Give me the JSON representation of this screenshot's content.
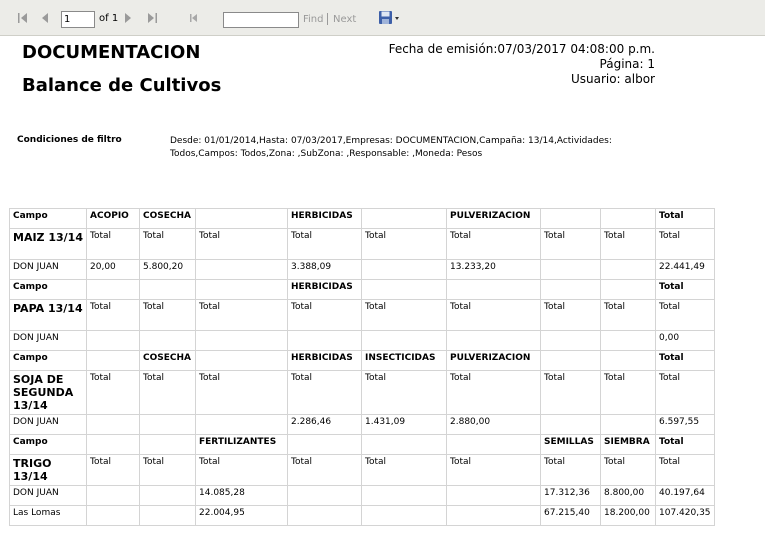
{
  "toolbar": {
    "page_value": "1",
    "of_label": "of 1",
    "find_label": "Find",
    "separator": "|",
    "next_label": "Next"
  },
  "report": {
    "company": "DOCUMENTACION",
    "title": "Balance de Cultivos",
    "emission": "Fecha de emisión:07/03/2017 04:08:00 p.m.",
    "page": "Página: 1",
    "user": "Usuario: albor",
    "filter_label": "Condiciones de filtro",
    "filter_text": "Desde: 01/01/2014,Hasta: 07/03/2017,Empresas: DOCUMENTACION,Campaña: 13/14,Actividades: Todos,Campos: Todos,Zona: ,SubZona: ,Responsable: ,Moneda: Pesos"
  },
  "table": {
    "campo": "Campo",
    "total": "Total",
    "sections": [
      {
        "headers": [
          "Campo",
          "ACOPIO",
          "COSECHA",
          "",
          "HERBICIDAS",
          "",
          "PULVERIZACION",
          "",
          "",
          "Total"
        ],
        "crop": "MAIZ 13/14",
        "rows": [
          [
            "DON JUAN",
            "20,00",
            "5.800,20",
            "",
            "3.388,09",
            "",
            "13.233,20",
            "",
            "",
            "22.441,49"
          ]
        ]
      },
      {
        "headers": [
          "Campo",
          "",
          "",
          "",
          "HERBICIDAS",
          "",
          "",
          "",
          "",
          "Total"
        ],
        "crop": "PAPA 13/14",
        "rows": [
          [
            "DON JUAN",
            "",
            "",
            "",
            "",
            "",
            "",
            "",
            "",
            "0,00"
          ]
        ]
      },
      {
        "headers": [
          "Campo",
          "",
          "COSECHA",
          "",
          "HERBICIDAS",
          "INSECTICIDAS",
          "PULVERIZACION",
          "",
          "",
          "Total"
        ],
        "crop": "SOJA DE SEGUNDA 13/14",
        "rows": [
          [
            "DON JUAN",
            "",
            "",
            "",
            "2.286,46",
            "1.431,09",
            "2.880,00",
            "",
            "",
            "6.597,55"
          ]
        ]
      },
      {
        "headers": [
          "Campo",
          "",
          "",
          "FERTILIZANTES",
          "",
          "",
          "",
          "SEMILLAS",
          "SIEMBRA",
          "Total"
        ],
        "crop": "TRIGO 13/14",
        "rows": [
          [
            "DON JUAN",
            "",
            "",
            "14.085,28",
            "",
            "",
            "",
            "17.312,36",
            "8.800,00",
            "40.197,64"
          ],
          [
            "Las Lomas",
            "",
            "",
            "22.004,95",
            "",
            "",
            "",
            "67.215,40",
            "18.200,00",
            "107.420,35"
          ]
        ]
      }
    ]
  }
}
